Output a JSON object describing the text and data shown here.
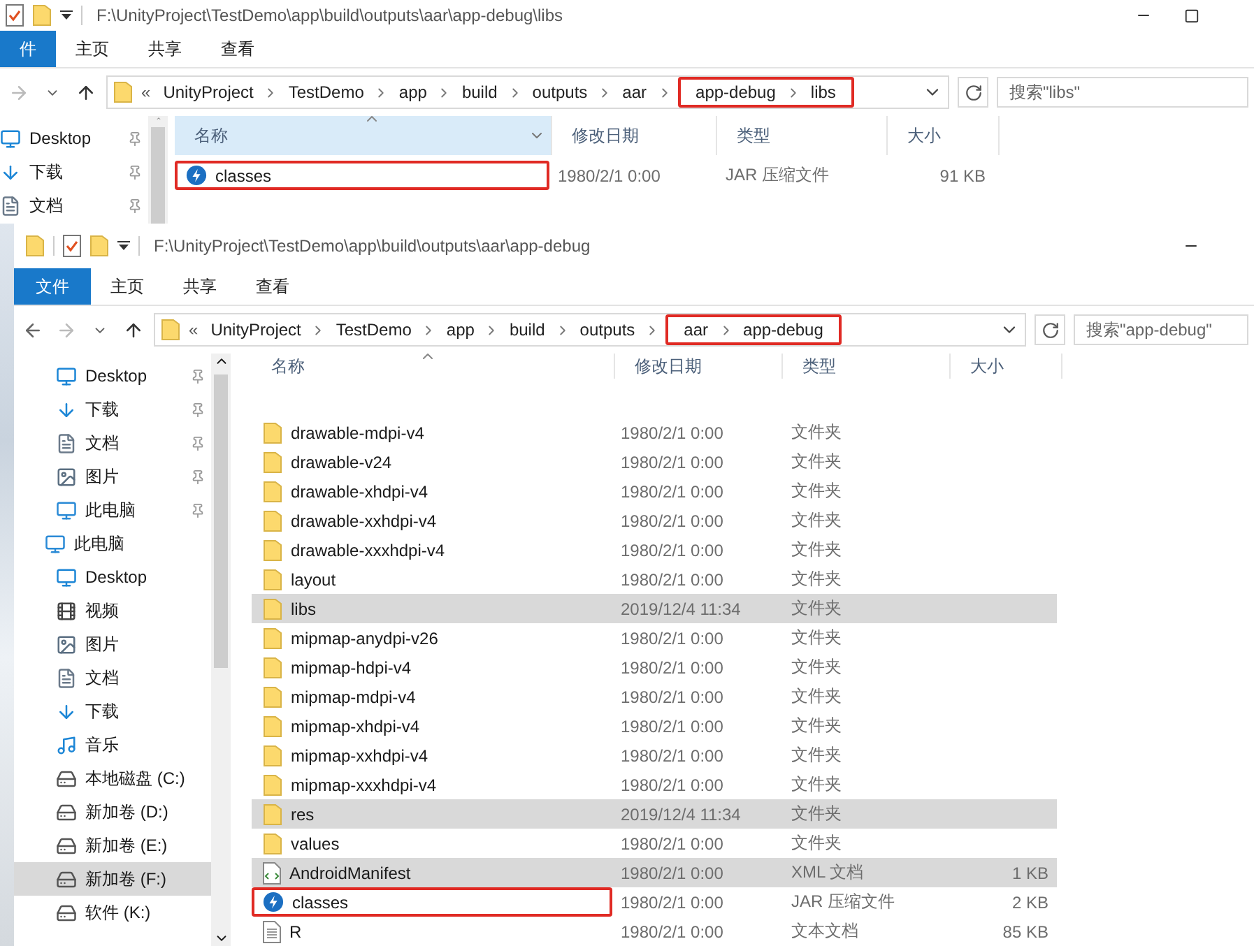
{
  "back_window": {
    "title": "F:\\UnityProject\\TestDemo\\app\\build\\outputs\\aar\\app-debug\\libs",
    "ribbon_tabs": [
      {
        "label": "件",
        "selected": true
      },
      {
        "label": "主页",
        "selected": false
      },
      {
        "label": "共享",
        "selected": false
      },
      {
        "label": "查看",
        "selected": false
      }
    ],
    "address": {
      "overflow_marker": "«",
      "crumbs": [
        {
          "label": "UnityProject",
          "highlighted": false
        },
        {
          "label": "TestDemo",
          "highlighted": false
        },
        {
          "label": "app",
          "highlighted": false
        },
        {
          "label": "build",
          "highlighted": false
        },
        {
          "label": "outputs",
          "highlighted": false
        },
        {
          "label": "aar",
          "highlighted": false
        },
        {
          "label": "app-debug",
          "highlighted": true
        },
        {
          "label": "libs",
          "highlighted": true
        }
      ]
    },
    "search": {
      "placeholder": "搜索\"libs\""
    },
    "nav": {
      "quick_access": [
        {
          "label": "Desktop",
          "kind": "desktop",
          "pinned": true,
          "selected": false
        },
        {
          "label": "下载",
          "kind": "download",
          "pinned": true,
          "selected": false
        },
        {
          "label": "文档",
          "kind": "document",
          "pinned": true,
          "selected": false
        }
      ]
    },
    "columns": [
      "名称",
      "修改日期",
      "类型",
      "大小"
    ],
    "rows": [
      {
        "name": "classes",
        "kind": "jar",
        "date": "1980/2/1 0:00",
        "type": "JAR 压缩文件",
        "size": "91 KB",
        "selected": false,
        "outlined": true
      }
    ]
  },
  "front_window": {
    "title": "F:\\UnityProject\\TestDemo\\app\\build\\outputs\\aar\\app-debug",
    "ribbon_tabs": [
      {
        "label": "文件",
        "selected": true
      },
      {
        "label": "主页",
        "selected": false
      },
      {
        "label": "共享",
        "selected": false
      },
      {
        "label": "查看",
        "selected": false
      }
    ],
    "address": {
      "overflow_marker": "«",
      "crumbs": [
        {
          "label": "UnityProject",
          "highlighted": false
        },
        {
          "label": "TestDemo",
          "highlighted": false
        },
        {
          "label": "app",
          "highlighted": false
        },
        {
          "label": "build",
          "highlighted": false
        },
        {
          "label": "outputs",
          "highlighted": false
        },
        {
          "label": "aar",
          "highlighted": true
        },
        {
          "label": "app-debug",
          "highlighted": true
        }
      ]
    },
    "search": {
      "placeholder": "搜索\"app-debug\""
    },
    "nav": {
      "quick_access": [
        {
          "label": "Desktop",
          "kind": "desktop",
          "pinned": true,
          "selected": false
        },
        {
          "label": "下载",
          "kind": "download",
          "pinned": true,
          "selected": false
        },
        {
          "label": "文档",
          "kind": "document",
          "pinned": true,
          "selected": false
        },
        {
          "label": "图片",
          "kind": "picture",
          "pinned": true,
          "selected": false
        },
        {
          "label": "此电脑",
          "kind": "pc",
          "pinned": true,
          "selected": false
        }
      ],
      "this_pc": {
        "label": "此电脑",
        "kind": "pc",
        "selected": false,
        "children": [
          {
            "label": "Desktop",
            "kind": "desktop",
            "selected": false
          },
          {
            "label": "视频",
            "kind": "video",
            "selected": false
          },
          {
            "label": "图片",
            "kind": "picture",
            "selected": false
          },
          {
            "label": "文档",
            "kind": "document",
            "selected": false
          },
          {
            "label": "下载",
            "kind": "download",
            "selected": false
          },
          {
            "label": "音乐",
            "kind": "music",
            "selected": false
          },
          {
            "label": "本地磁盘 (C:)",
            "kind": "drive",
            "selected": false
          },
          {
            "label": "新加卷 (D:)",
            "kind": "drive",
            "selected": false
          },
          {
            "label": "新加卷 (E:)",
            "kind": "drive",
            "selected": false
          },
          {
            "label": "新加卷 (F:)",
            "kind": "drive",
            "selected": true
          },
          {
            "label": "软件 (K:)",
            "kind": "drive",
            "selected": false
          }
        ]
      }
    },
    "columns": [
      "名称",
      "修改日期",
      "类型",
      "大小"
    ],
    "rows": [
      {
        "name": "drawable-mdpi-v4",
        "kind": "folder",
        "date": "1980/2/1 0:00",
        "type": "文件夹",
        "selected": false,
        "outlined": false
      },
      {
        "name": "drawable-v24",
        "kind": "folder",
        "date": "1980/2/1 0:00",
        "type": "文件夹",
        "selected": false,
        "outlined": false
      },
      {
        "name": "drawable-xhdpi-v4",
        "kind": "folder",
        "date": "1980/2/1 0:00",
        "type": "文件夹",
        "selected": false,
        "outlined": false
      },
      {
        "name": "drawable-xxhdpi-v4",
        "kind": "folder",
        "date": "1980/2/1 0:00",
        "type": "文件夹",
        "selected": false,
        "outlined": false
      },
      {
        "name": "drawable-xxxhdpi-v4",
        "kind": "folder",
        "date": "1980/2/1 0:00",
        "type": "文件夹",
        "selected": false,
        "outlined": false
      },
      {
        "name": "layout",
        "kind": "folder",
        "date": "1980/2/1 0:00",
        "type": "文件夹",
        "selected": false,
        "outlined": false
      },
      {
        "name": "libs",
        "kind": "folder",
        "date": "2019/12/4 11:34",
        "type": "文件夹",
        "selected": true,
        "outlined": false
      },
      {
        "name": "mipmap-anydpi-v26",
        "kind": "folder",
        "date": "1980/2/1 0:00",
        "type": "文件夹",
        "selected": false,
        "outlined": false
      },
      {
        "name": "mipmap-hdpi-v4",
        "kind": "folder",
        "date": "1980/2/1 0:00",
        "type": "文件夹",
        "selected": false,
        "outlined": false
      },
      {
        "name": "mipmap-mdpi-v4",
        "kind": "folder",
        "date": "1980/2/1 0:00",
        "type": "文件夹",
        "selected": false,
        "outlined": false
      },
      {
        "name": "mipmap-xhdpi-v4",
        "kind": "folder",
        "date": "1980/2/1 0:00",
        "type": "文件夹",
        "selected": false,
        "outlined": false
      },
      {
        "name": "mipmap-xxhdpi-v4",
        "kind": "folder",
        "date": "1980/2/1 0:00",
        "type": "文件夹",
        "selected": false,
        "outlined": false
      },
      {
        "name": "mipmap-xxxhdpi-v4",
        "kind": "folder",
        "date": "1980/2/1 0:00",
        "type": "文件夹",
        "selected": false,
        "outlined": false
      },
      {
        "name": "res",
        "kind": "folder",
        "date": "2019/12/4 11:34",
        "type": "文件夹",
        "selected": true,
        "outlined": false
      },
      {
        "name": "values",
        "kind": "folder",
        "date": "1980/2/1 0:00",
        "type": "文件夹",
        "selected": false,
        "outlined": false
      },
      {
        "name": "AndroidManifest",
        "kind": "xml",
        "date": "1980/2/1 0:00",
        "type": "XML 文档",
        "size": "1 KB",
        "selected": true,
        "outlined": false
      },
      {
        "name": "classes",
        "kind": "jar",
        "date": "1980/2/1 0:00",
        "type": "JAR 压缩文件",
        "size": "2 KB",
        "selected": false,
        "outlined": true
      },
      {
        "name": "R",
        "kind": "text",
        "date": "1980/2/1 0:00",
        "type": "文本文档",
        "size": "85 KB",
        "selected": false,
        "outlined": false
      }
    ]
  }
}
